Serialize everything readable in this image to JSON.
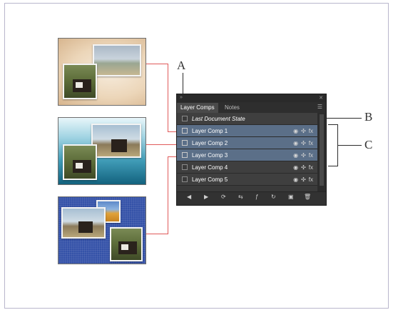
{
  "callouts": {
    "a": "A",
    "b": "B",
    "c": "C"
  },
  "panel": {
    "collapse_icon": "»",
    "close_icon": "✕",
    "tabs": [
      {
        "label": "Layer Comps"
      },
      {
        "label": "Notes"
      }
    ],
    "menu_icon": "☰",
    "rows": [
      {
        "label": "Last Document State",
        "icons": false,
        "italic": true
      },
      {
        "label": "Layer Comp 1",
        "icons": true
      },
      {
        "label": "Layer Comp 2",
        "icons": true
      },
      {
        "label": "Layer Comp 3",
        "icons": true
      },
      {
        "label": "Layer Comp 4",
        "icons": true
      },
      {
        "label": "Layer Comp 5",
        "icons": true
      }
    ],
    "row_icons": {
      "visibility": "◉",
      "position": "✣",
      "effects": "fx"
    },
    "toolbar": [
      "◀",
      "▶",
      "⟳",
      "⇆",
      "ƒ",
      "↻",
      "▣",
      "🗑"
    ]
  },
  "colors": {
    "leader": "#e05a5a",
    "selection": "#5b6f88",
    "panel_bg": "#3a3a3a"
  }
}
